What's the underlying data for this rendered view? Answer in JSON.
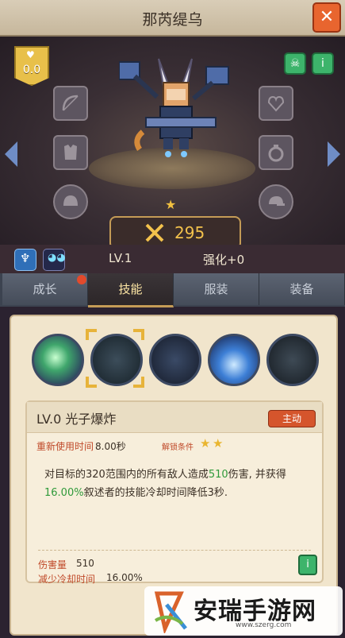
{
  "window": {
    "title": "那芮缇乌",
    "close_icon": "close-x-icon"
  },
  "character": {
    "heart_value": "0.0",
    "star_count": 1,
    "power": "295",
    "level": "LV.1",
    "enhance": "强化+0",
    "left_slots": [
      "bow-icon",
      "armor-icon",
      "helmet-icon"
    ],
    "right_slots": [
      "heart-gem-icon",
      "ring-icon",
      "cap-icon"
    ],
    "top_right_buttons": [
      "skull-icon",
      "info-icon"
    ]
  },
  "tabs": [
    {
      "label": "成长",
      "active": false,
      "badge": true
    },
    {
      "label": "技能",
      "active": true
    },
    {
      "label": "服装",
      "active": false
    },
    {
      "label": "装备",
      "active": false
    }
  ],
  "skills": {
    "icons": [
      "photon-burst-skill",
      "locked-skill-2",
      "locked-skill-3",
      "blue-flame-skill",
      "locked-skill-5"
    ],
    "selected_index": 1
  },
  "detail": {
    "name": "LV.0 光子爆炸",
    "type_tag": "主动",
    "cooldown_label": "重新使用时间",
    "cooldown_value": "8.00秒",
    "unlock_label": "解锁条件",
    "unlock_stars": 2,
    "desc_part1": "对目标的320范围内的所有敌人造成",
    "desc_hl1": "510",
    "desc_part2": "伤害, 并获得",
    "desc_hl2": "16.00%",
    "desc_part3": "叙述者的技能冷却时间降低3秒.",
    "stat1_label": "伤害量",
    "stat1_value": "510",
    "stat2_label": "减少冷却时间",
    "stat2_value": "16.00%"
  },
  "watermark": {
    "text": "安瑞手游网",
    "url": "www.szerg.com"
  },
  "colors": {
    "accent_gold": "#c49b56",
    "highlight_green": "#2f9a3a",
    "label_red": "#c04a2a"
  }
}
